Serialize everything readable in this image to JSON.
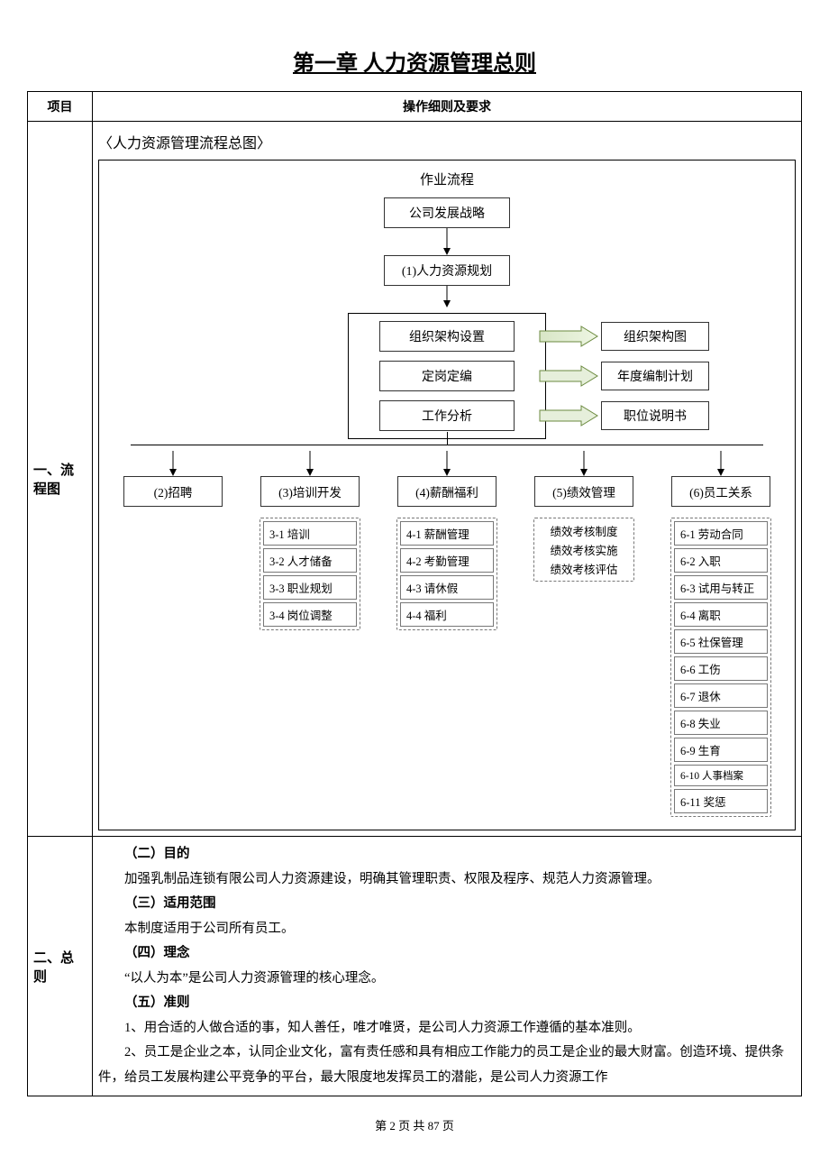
{
  "chapter_title": "第一章 人力资源管理总则",
  "table": {
    "col1": "项目",
    "col2": "操作细则及要求"
  },
  "row1_label": "一、流程图",
  "flow": {
    "subtitle": "〈人力资源管理流程总图〉",
    "heading": "作业流程",
    "top1": "公司发展战略",
    "top2": "(1)人力资源规划",
    "inner": {
      "a": "组织架构设置",
      "a_out": "组织架构图",
      "b": "定岗定编",
      "b_out": "年度编制计划",
      "c": "工作分析",
      "c_out": "职位说明书"
    },
    "branches": [
      {
        "title": "(2)招聘",
        "items": []
      },
      {
        "title": "(3)培训开发",
        "items": [
          "3-1 培训",
          "3-2 人才储备",
          "3-3 职业规划",
          "3-4 岗位调整"
        ]
      },
      {
        "title": "(4)薪酬福利",
        "items": [
          "4-1 薪酬管理",
          "4-2 考勤管理",
          "4-3 请休假",
          "4-4 福利"
        ]
      },
      {
        "title": "(5)绩效管理",
        "items": [
          "绩效考核制度",
          "绩效考核实施",
          "绩效考核评估"
        ],
        "compact": true
      },
      {
        "title": "(6)员工关系",
        "items": [
          "6-1 劳动合同",
          "6-2  入职",
          "6-3 试用与转正",
          "6-4  离职",
          "6-5  社保管理",
          "6-6  工伤",
          "6-7  退休",
          "6-8  失业",
          "6-9  生育",
          "6-10  人事档案",
          "6-11  奖惩"
        ]
      }
    ]
  },
  "row2_label": "二、总则",
  "principles": {
    "h2": "（二）目的",
    "p2": "加强乳制品连锁有限公司人力资源建设，明确其管理职责、权限及程序、规范人力资源管理。",
    "h3": "（三）适用范围",
    "p3": "本制度适用于公司所有员工。",
    "h4": "（四）理念",
    "p4": "“以人为本”是公司人力资源管理的核心理念。",
    "h5": "（五）准则",
    "p5a": "1、用合适的人做合适的事，知人善任，唯才唯贤，是公司人力资源工作遵循的基本准则。",
    "p5b": "2、员工是企业之本，认同企业文化，富有责任感和具有相应工作能力的员工是企业的最大财富。创造环境、提供条件，给员工发展构建公平竞争的平台，最大限度地发挥员工的潜能，是公司人力资源工作"
  },
  "footer": "第 2 页 共 87 页"
}
